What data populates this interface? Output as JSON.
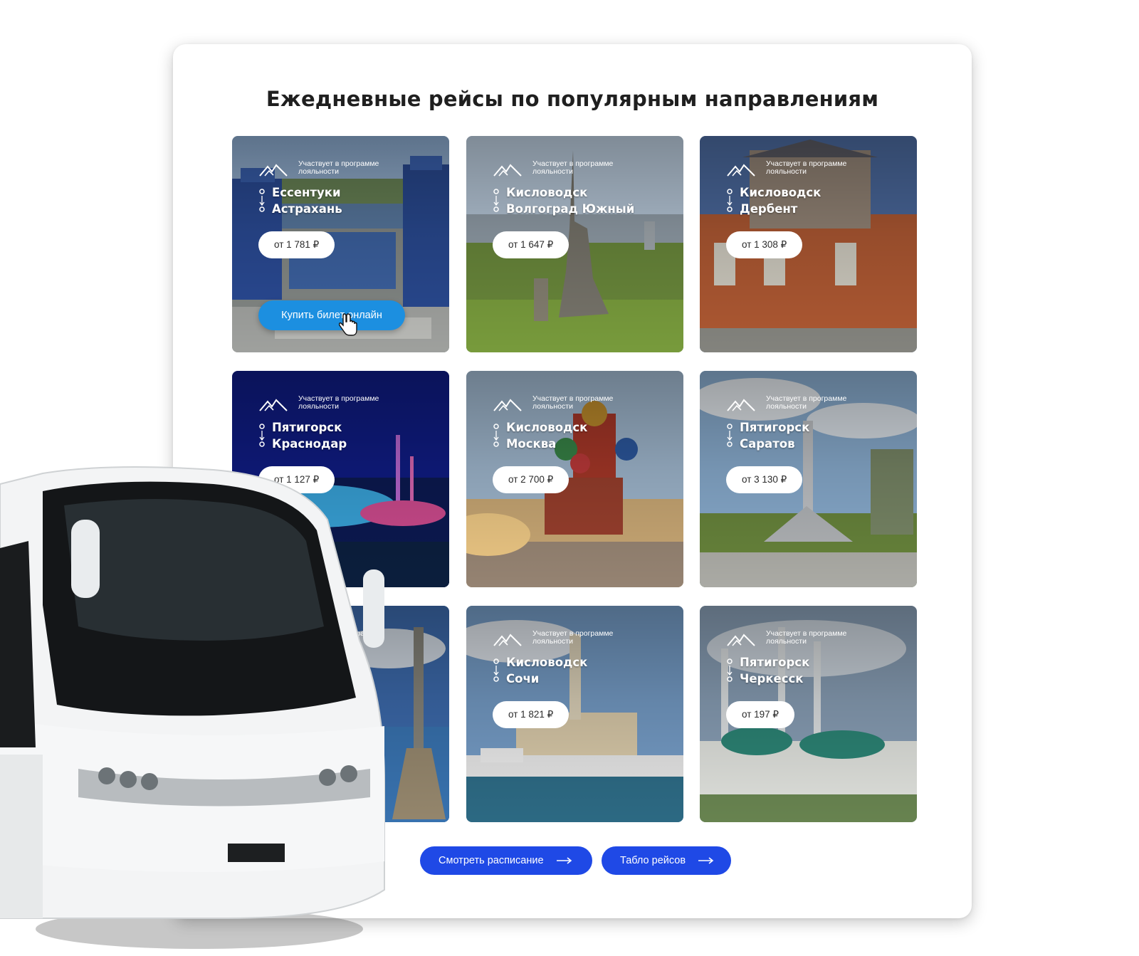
{
  "section": {
    "title": "Ежедневные рейсы по популярным направлениям"
  },
  "loyalty_text": "Участвует в программе лояльности",
  "cards": [
    {
      "from": "Ессентуки",
      "to": "Астрахань",
      "price": "от 1 781 ₽",
      "buy_label": "Купить билет онлайн",
      "theme": "city-river"
    },
    {
      "from": "Кисловодск",
      "to": "Волгоград Южный",
      "price": "от 1 647 ₽",
      "theme": "statue-park"
    },
    {
      "from": "Кисловодск",
      "to": "Дербент",
      "price": "от 1 308 ₽",
      "theme": "station-building"
    },
    {
      "from": "Пятигорск",
      "to": "Краснодар",
      "price": "от 1 127 ₽",
      "theme": "night-fountain"
    },
    {
      "from": "Кисловодск",
      "to": "Москва",
      "price": "от 2 700 ₽",
      "theme": "cathedral"
    },
    {
      "from": "Пятигорск",
      "to": "Саратов",
      "price": "от 3 130 ₽",
      "theme": "memorial"
    },
    {
      "from": "",
      "to": "",
      "price": "",
      "theme": "sea-column"
    },
    {
      "from": "Кисловодск",
      "to": "Сочи",
      "price": "от 1 821 ₽",
      "theme": "sea-port"
    },
    {
      "from": "Пятигорск",
      "to": "Черкесск",
      "price": "от 197 ₽",
      "theme": "mosque"
    }
  ],
  "actions": {
    "schedule_label": "Смотреть расписание",
    "board_label": "Табло рейсов"
  },
  "colors": {
    "primary": "#1f49e6",
    "buy_button": "#1c8fe0",
    "title": "#1f1f1f"
  },
  "icons": [
    "mountain-logo-icon",
    "route-icon",
    "arrow-right-icon",
    "hand-cursor-icon"
  ]
}
